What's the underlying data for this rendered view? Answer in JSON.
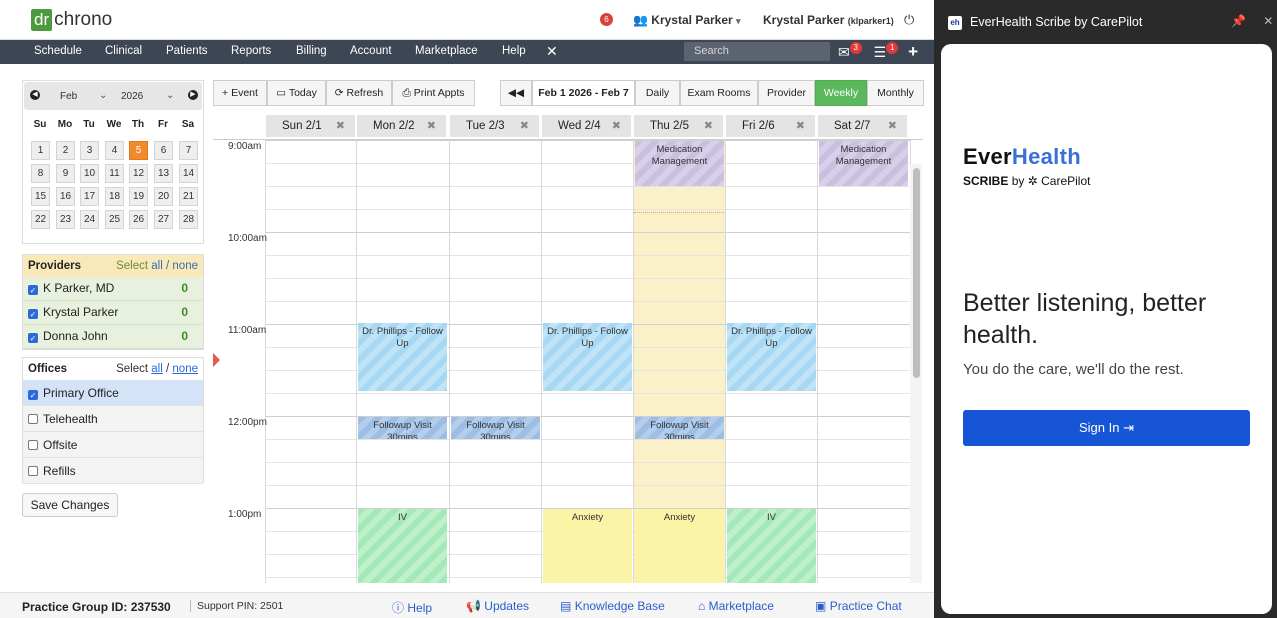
{
  "header": {
    "logo_dr": "dr",
    "logo_chrono": "chrono",
    "notif_count": "6",
    "user_menu": "Krystal Parker",
    "user_name": "Krystal Parker",
    "user_id": "(klparker1)",
    "power_icon": "power-icon"
  },
  "nav": {
    "items": [
      "Schedule",
      "Clinical",
      "Patients",
      "Reports",
      "Billing",
      "Account",
      "Marketplace",
      "Help"
    ],
    "search_placeholder": "Search",
    "mail_badge": "3",
    "tasks_badge": "1"
  },
  "minical": {
    "month": "Feb",
    "year": "2026",
    "dow": [
      "Su",
      "Mo",
      "Tu",
      "We",
      "Th",
      "Fr",
      "Sa"
    ],
    "weeks": [
      [
        "1",
        "2",
        "3",
        "4",
        "5",
        "6",
        "7"
      ],
      [
        "8",
        "9",
        "10",
        "11",
        "12",
        "13",
        "14"
      ],
      [
        "15",
        "16",
        "17",
        "18",
        "19",
        "20",
        "21"
      ],
      [
        "22",
        "23",
        "24",
        "25",
        "26",
        "27",
        "28"
      ]
    ],
    "today": "5"
  },
  "providers": {
    "title": "Providers",
    "select_prefix": "Select",
    "all": "all",
    "sep": "/",
    "none": "none",
    "items": [
      {
        "name": "K Parker, MD",
        "count": "0"
      },
      {
        "name": "Krystal Parker",
        "count": "0"
      },
      {
        "name": "Donna John",
        "count": "0"
      }
    ]
  },
  "offices": {
    "title": "Offices",
    "select_prefix": "Select",
    "all": "all",
    "sep": "/",
    "none": "none",
    "items": [
      "Primary Office",
      "Telehealth",
      "Offsite",
      "Refills"
    ]
  },
  "save_label": "Save Changes",
  "toolbar": {
    "event": "Event",
    "today": "Today",
    "refresh": "Refresh",
    "print": "Print Appts",
    "range": "Feb 1 2026 - Feb 7",
    "views": [
      "Daily",
      "Exam Rooms",
      "Provider",
      "Weekly",
      "Monthly"
    ],
    "active_view": "Weekly"
  },
  "calendar": {
    "days": [
      "Sun 2/1",
      "Mon 2/2",
      "Tue 2/3",
      "Wed 2/4",
      "Thu 2/5",
      "Fri 2/6",
      "Sat 2/7"
    ],
    "times": [
      "9:00am",
      "10:00am",
      "11:00am",
      "12:00pm",
      "1:00pm"
    ],
    "events": [
      {
        "day": "Thu",
        "text": "Medication Management",
        "color": "purple"
      },
      {
        "day": "Sat",
        "text": "Medication Management",
        "color": "purple"
      },
      {
        "day": "Mon",
        "text": "Dr. Phillips - Follow Up",
        "color": "blue"
      },
      {
        "day": "Wed",
        "text": "Dr. Phillips - Follow Up",
        "color": "blue"
      },
      {
        "day": "Fri",
        "text": "Dr. Phillips - Follow Up",
        "color": "blue"
      },
      {
        "day": "Mon",
        "text": "Followup Visit",
        "sub": "30mins",
        "color": "blue2"
      },
      {
        "day": "Tue",
        "text": "Followup Visit",
        "sub": "30mins",
        "color": "blue2"
      },
      {
        "day": "Thu",
        "text": "Followup Visit",
        "sub": "30mins",
        "color": "blue2"
      },
      {
        "day": "Mon",
        "text": "IV",
        "color": "green"
      },
      {
        "day": "Wed",
        "text": "Anxiety",
        "color": "yellow"
      },
      {
        "day": "Thu",
        "text": "Anxiety",
        "color": "yellow"
      },
      {
        "day": "Fri",
        "text": "IV",
        "color": "green"
      }
    ]
  },
  "footer": {
    "practice_id": "Practice Group ID: 237530",
    "support_pin": "Support PIN: 2501",
    "links": [
      "Help",
      "Updates",
      "Knowledge Base",
      "Marketplace",
      "Practice Chat"
    ]
  },
  "scribe": {
    "panel_title": "EverHealth Scribe by CarePilot",
    "brand_ever": "Ever",
    "brand_health": "Health",
    "sub_scribe": "SCRIBE",
    "sub_by": "by",
    "sub_carepilot": "CarePilot",
    "headline": "Better listening, better health.",
    "tagline": "You do the care, we'll do the rest.",
    "signin": "Sign In"
  },
  "colors": {
    "nav_bg": "#3d4654",
    "weekly_active": "#5cb85c",
    "today_orange": "#f08a2c",
    "signin_blue": "#1656d6"
  }
}
